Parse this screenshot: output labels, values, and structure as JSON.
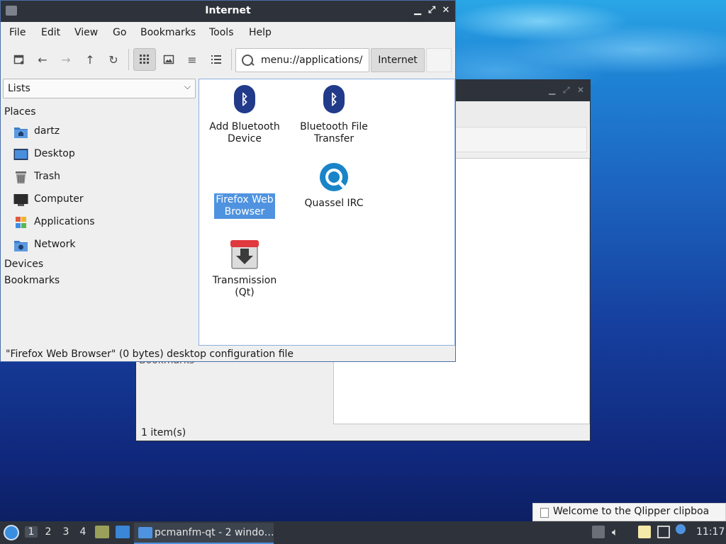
{
  "main_window": {
    "title": "Internet",
    "menu": [
      "File",
      "Edit",
      "View",
      "Go",
      "Bookmarks",
      "Tools",
      "Help"
    ],
    "path": "menu://applications/",
    "breadcrumb": "Internet",
    "side_pane": {
      "mode": "Lists",
      "places_heading": "Places",
      "places": [
        {
          "label": "dartz",
          "icon": "home-folder-icon"
        },
        {
          "label": "Desktop",
          "icon": "desktop-icon"
        },
        {
          "label": "Trash",
          "icon": "trash-icon"
        },
        {
          "label": "Computer",
          "icon": "computer-icon"
        },
        {
          "label": "Applications",
          "icon": "applications-icon"
        },
        {
          "label": "Network",
          "icon": "network-icon"
        }
      ],
      "devices_heading": "Devices",
      "bookmarks_heading": "Bookmarks"
    },
    "items": [
      {
        "label_l1": "Add Bluetooth",
        "label_l2": "Device",
        "icon": "bluetooth-icon"
      },
      {
        "label_l1": "Bluetooth File",
        "label_l2": "Transfer",
        "icon": "bluetooth-icon"
      },
      {
        "label_l1": "Firefox Web",
        "label_l2": "Browser",
        "icon": "firefox-icon",
        "selected": true
      },
      {
        "label_l1": "Quassel IRC",
        "label_l2": "",
        "icon": "quassel-icon"
      },
      {
        "label_l1": "Transmission",
        "label_l2": "(Qt)",
        "icon": "transmission-icon"
      }
    ],
    "status": "\"Firefox Web Browser\" (0 bytes) desktop configuration file"
  },
  "background_window": {
    "status": "1 item(s)",
    "ghost_text": "Bookmarks"
  },
  "notification": {
    "text": "Welcome to the Qlipper clipboa"
  },
  "panel": {
    "desktops": [
      "1",
      "2",
      "3",
      "4"
    ],
    "current_desktop": "1",
    "task_label": "pcmanfm-qt - 2 windo…",
    "clock": "11:17"
  },
  "colors": {
    "titlebar": "#2e333b",
    "selection": "#4f93e0",
    "bluetooth": "#213a8a"
  }
}
